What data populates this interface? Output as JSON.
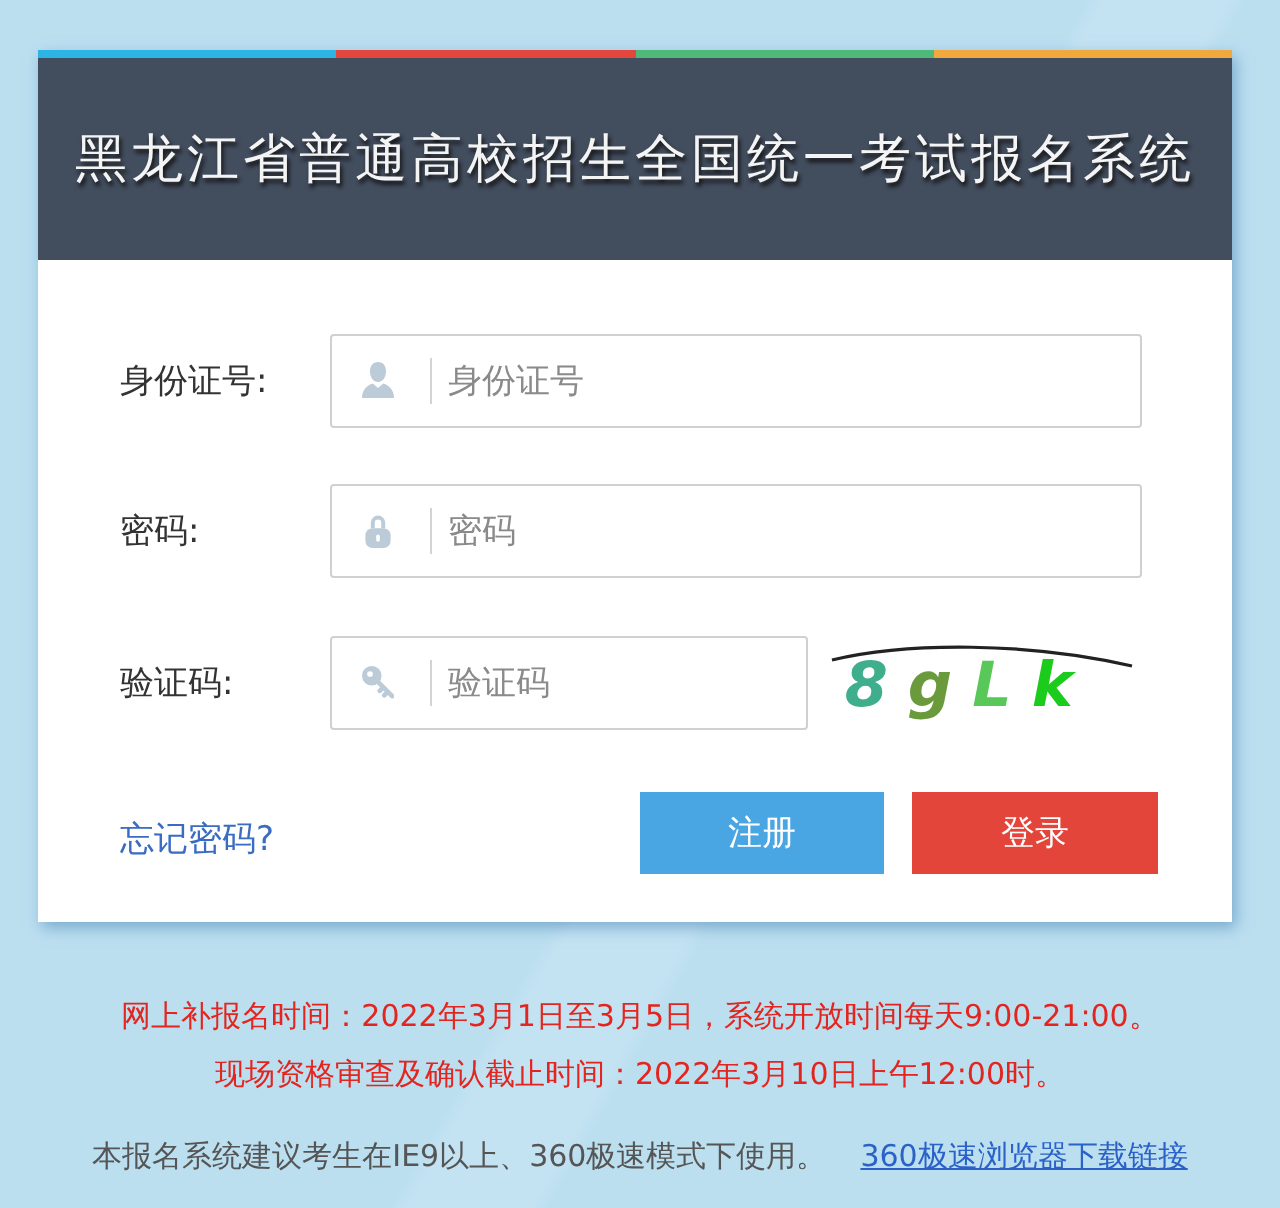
{
  "header": {
    "title": "黑龙江省普通高校招生全国统一考试报名系统"
  },
  "fields": [
    {
      "kind": "username",
      "label": "身份证号:",
      "placeholder": "身份证号"
    },
    {
      "kind": "password",
      "label": "密码:",
      "placeholder": "密码"
    },
    {
      "kind": "captcha",
      "label": "验证码:",
      "placeholder": "验证码",
      "captcha": "8gLk"
    }
  ],
  "forgot_link": "忘记密码?",
  "buttons": [
    {
      "kind": "register",
      "label": "注册"
    },
    {
      "kind": "login",
      "label": "登录"
    }
  ],
  "notices": [
    "网上补报名时间：2022年3月1日至3月5日，系统开放时间每天9:00-21:00。",
    "现场资格审查及确认截止时间：2022年3月10日上午12:00时。"
  ],
  "footer": {
    "text": "本报名系统建议考生在IE9以上、360极速模式下使用。",
    "link": "360极速浏览器下载链接"
  }
}
